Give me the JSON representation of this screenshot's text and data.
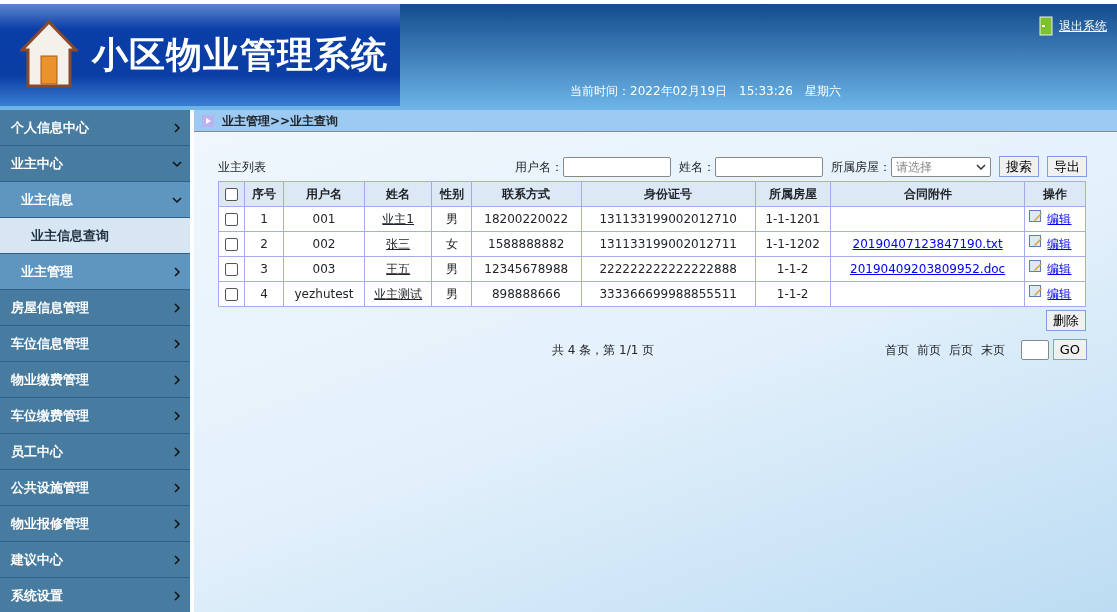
{
  "header": {
    "title": "小区物业管理系统",
    "logout": "退出系统",
    "clock": "当前时间：2022年02月19日　15:33:26　星期六"
  },
  "sidebar": {
    "items": [
      {
        "label": "个人信息中心",
        "expanded": false,
        "selected": false
      },
      {
        "label": "业主中心",
        "expanded": true,
        "selected": false,
        "children": [
          {
            "label": "业主信息",
            "expanded": true,
            "selected": false,
            "children": [
              {
                "label": "业主信息查询",
                "selected": true
              }
            ]
          },
          {
            "label": "业主管理",
            "expanded": false,
            "selected": false
          }
        ]
      },
      {
        "label": "房屋信息管理",
        "expanded": false,
        "selected": false
      },
      {
        "label": "车位信息管理",
        "expanded": false,
        "selected": false
      },
      {
        "label": "物业缴费管理",
        "expanded": false,
        "selected": false
      },
      {
        "label": "车位缴费管理",
        "expanded": false,
        "selected": false
      },
      {
        "label": "员工中心",
        "expanded": false,
        "selected": false
      },
      {
        "label": "公共设施管理",
        "expanded": false,
        "selected": false
      },
      {
        "label": "物业报修管理",
        "expanded": false,
        "selected": false
      },
      {
        "label": "建议中心",
        "expanded": false,
        "selected": false
      },
      {
        "label": "系统设置",
        "expanded": false,
        "selected": false
      }
    ]
  },
  "breadcrumb": "业主管理>>业主查询",
  "list_title": "业主列表",
  "filters": {
    "username_label": "用户名：",
    "name_label": "姓名：",
    "house_label": "所属房屋：",
    "house_placeholder": "请选择",
    "search": "搜索",
    "export": "导出"
  },
  "table": {
    "select_all_checked": false,
    "columns": [
      "序号",
      "用户名",
      "姓名",
      "性别",
      "联系方式",
      "身份证号",
      "所属房屋",
      "合同附件",
      "操作"
    ],
    "rows": [
      {
        "checked": false,
        "cells": [
          "1",
          "001",
          "业主1",
          "男",
          "18200220022",
          "131133199002012710",
          "1-1-1201",
          ""
        ],
        "action": "编辑"
      },
      {
        "checked": false,
        "cells": [
          "2",
          "002",
          "张三",
          "女",
          "1588888882",
          "131133199002012711",
          "1-1-1202",
          "20190407123847190.txt"
        ],
        "action": "编辑"
      },
      {
        "checked": false,
        "cells": [
          "3",
          "003",
          "王五",
          "男",
          "12345678988",
          "222222222222222888",
          "1-1-2",
          "20190409203809952.doc"
        ],
        "action": "编辑"
      },
      {
        "checked": false,
        "cells": [
          "4",
          "yezhutest",
          "业主测试",
          "男",
          "898888666",
          "333366699988855511",
          "1-1-2",
          ""
        ],
        "action": "编辑"
      }
    ]
  },
  "delete": "删除",
  "pager": {
    "summary": "共 4 条，第 1/1 页",
    "links": [
      "首页",
      "前页",
      "后页",
      "末页"
    ],
    "go": "GO"
  }
}
